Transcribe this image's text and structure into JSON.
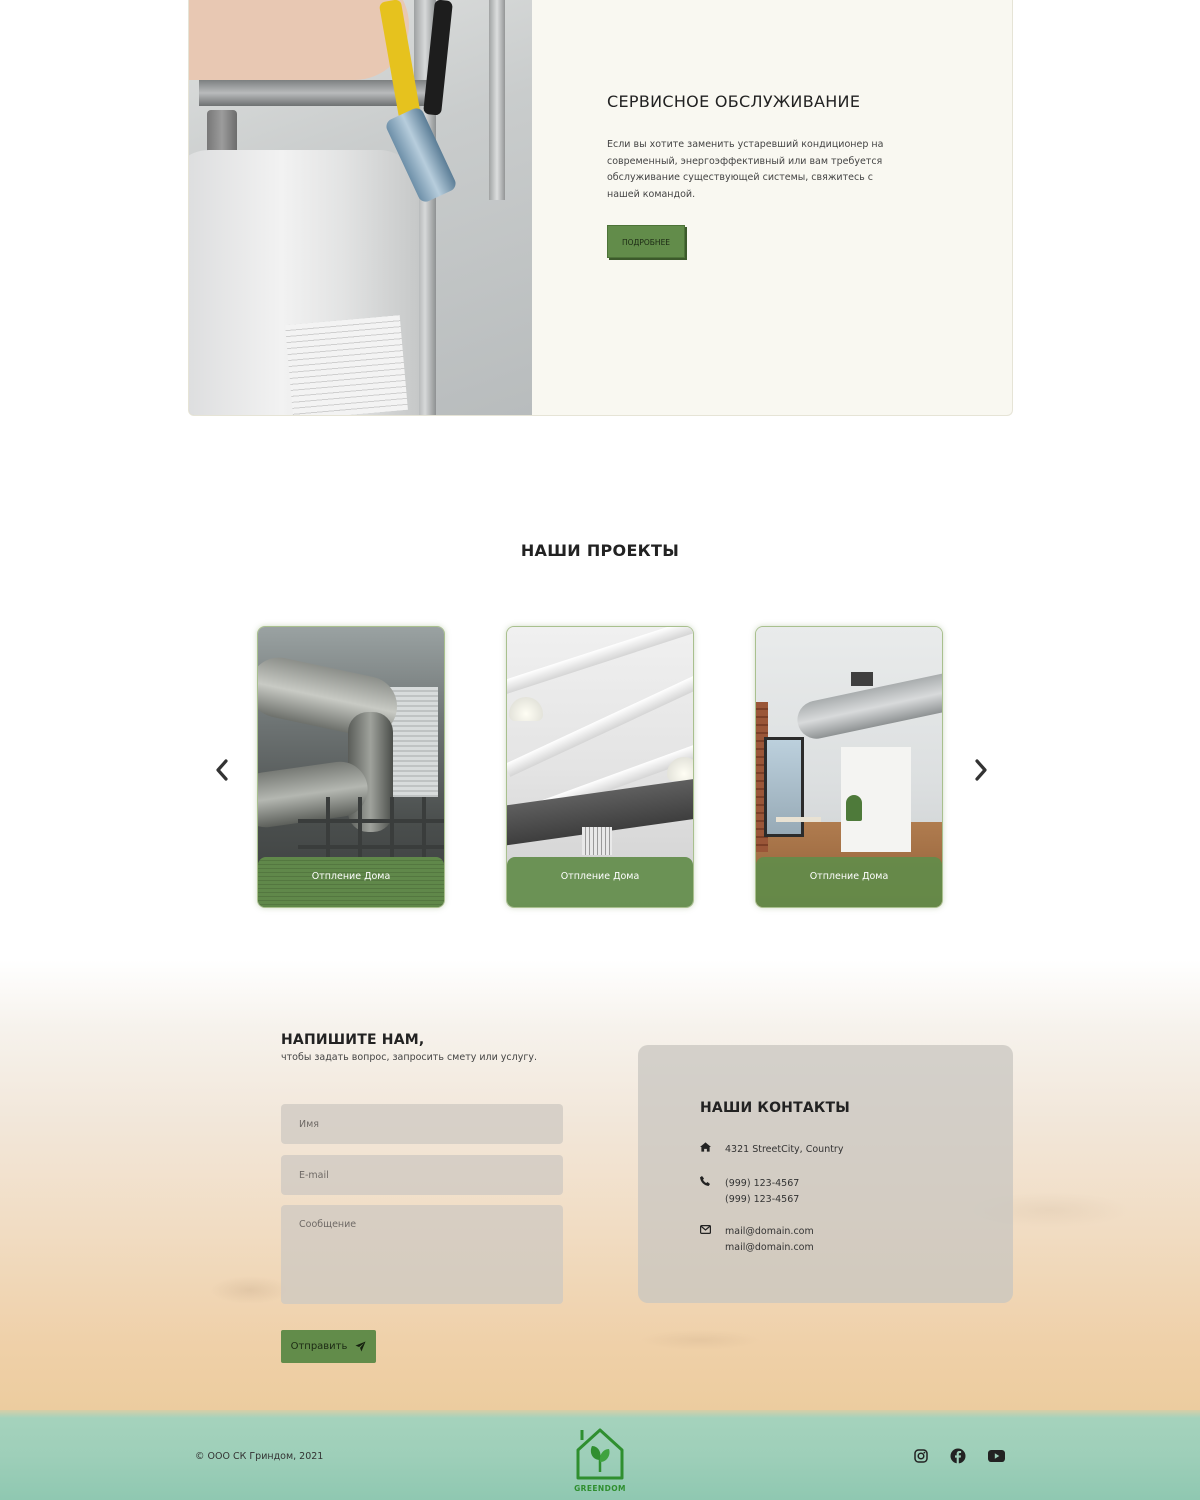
{
  "service": {
    "title": "СЕРВИСНОЕ ОБСЛУЖИВАНИЕ",
    "description": "Если вы хотите заменить устаревший кондиционер на современный, энергоэффективный или вам требуется обслуживание существующей системы, свяжитесь с нашей командой.",
    "button_label": "ПОДРОБНЕЕ"
  },
  "projects": {
    "title": "НАШИ ПРОЕКТЫ",
    "prev_icon": "chevron-left-icon",
    "next_icon": "chevron-right-icon",
    "cards": [
      {
        "caption": "Отпление Дома"
      },
      {
        "caption": "Отпление Дома"
      },
      {
        "caption": "Отпление Дома"
      }
    ]
  },
  "contact_form": {
    "title": "НАПИШИТЕ НАМ,",
    "subtitle": "чтобы задать вопрос, запросить смету или услугу.",
    "name_placeholder": "Имя",
    "email_placeholder": "E-mail",
    "message_placeholder": "Сообщение",
    "send_label": "Отправить",
    "send_icon": "paper-plane-icon"
  },
  "contacts": {
    "title": "НАШИ КОНТАКТЫ",
    "address": "4321 StreetCity, Country",
    "phone_1": "(999) 123-4567",
    "phone_2": "(999) 123-4567",
    "email_1": "mail@domain.com",
    "email_2": "mail@domain.com"
  },
  "footer": {
    "copyright": "© ООО СК Гриндом, 2021",
    "logo_text": "GREENDOM",
    "social": [
      "instagram-icon",
      "facebook-icon",
      "youtube-icon"
    ]
  },
  "colors": {
    "accent_green": "#628c4a",
    "logo_green": "#2f8f2f",
    "footer_teal": "#9ecfb9"
  }
}
